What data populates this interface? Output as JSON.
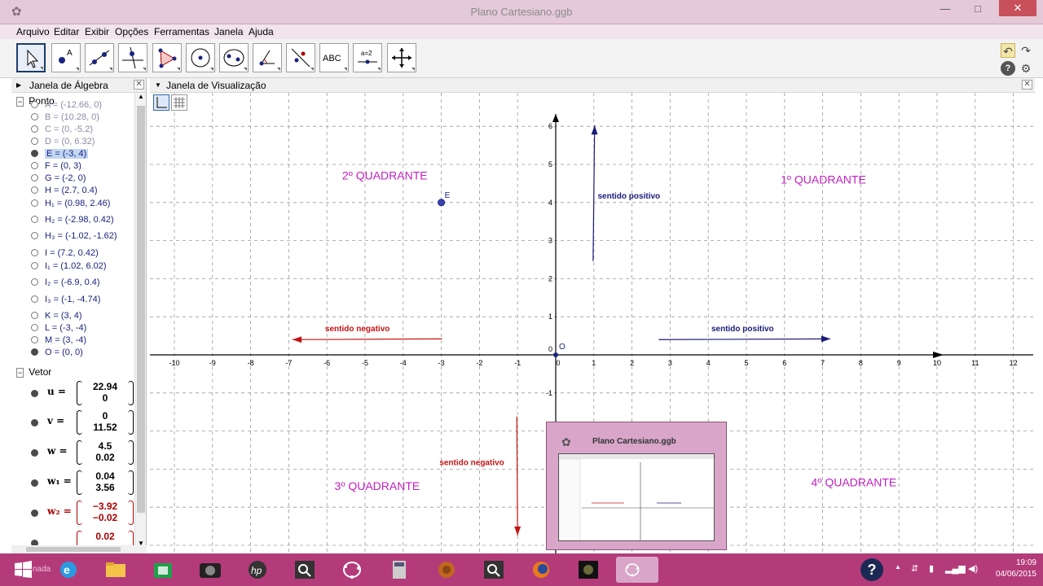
{
  "window": {
    "title": "Plano Cartesiano.ggb",
    "min_label": "—",
    "max_label": "□",
    "close_label": "✕"
  },
  "menu": [
    "Arquivo",
    "Editar",
    "Exibir",
    "Opções",
    "Ferramentas",
    "Janela",
    "Ajuda"
  ],
  "toolbar": {
    "tools": [
      "move-tool",
      "point-tool",
      "line-tool",
      "perpendicular-line-tool",
      "polygon-tool",
      "circle-tool",
      "conic-tool",
      "angle-tool",
      "reflect-tool",
      "text-tool",
      "slider-tool",
      "move-view-tool"
    ],
    "text_tool_label": "ABC",
    "slider_tool_label": "a=2",
    "undo": "↶",
    "redo": "↷",
    "help": "?",
    "settings": "⚙"
  },
  "algebra": {
    "title": "Janela de Álgebra",
    "close": "✕",
    "group_points": "Ponto",
    "points": [
      {
        "label": "A = (-12.66, 0)",
        "shown": false,
        "aux": true
      },
      {
        "label": "B = (10.28, 0)",
        "shown": false,
        "aux": true
      },
      {
        "label": "C = (0, -5.2)",
        "shown": false,
        "aux": true
      },
      {
        "label": "D = (0, 6.32)",
        "shown": false,
        "aux": true
      },
      {
        "label": "E = (-3, 4)",
        "shown": true,
        "aux": false,
        "selected": true
      },
      {
        "label": "F = (0, 3)",
        "shown": false,
        "aux": false
      },
      {
        "label": "G = (-2, 0)",
        "shown": false,
        "aux": false
      },
      {
        "label": "H = (2.7, 0.4)",
        "shown": false,
        "aux": false
      },
      {
        "label": "H₁ = (0.98, 2.46)",
        "shown": false,
        "aux": false
      },
      {
        "label": "H₂ = (-2.98, 0.42)",
        "shown": false,
        "aux": false
      },
      {
        "label": "H₃ = (-1.02, -1.62)",
        "shown": false,
        "aux": false
      },
      {
        "label": "I = (7.2, 0.42)",
        "shown": false,
        "aux": false
      },
      {
        "label": "I₁ = (1.02, 6.02)",
        "shown": false,
        "aux": false
      },
      {
        "label": "I₂ = (-6.9, 0.4)",
        "shown": false,
        "aux": false
      },
      {
        "label": "I₃ = (-1, -4.74)",
        "shown": false,
        "aux": false
      },
      {
        "label": "K = (3, 4)",
        "shown": false,
        "aux": false
      },
      {
        "label": "L = (-3, -4)",
        "shown": false,
        "aux": false
      },
      {
        "label": "M = (3, -4)",
        "shown": false,
        "aux": false
      },
      {
        "label": "O = (0, 0)",
        "shown": true,
        "aux": false
      }
    ],
    "group_vectors": "Vetor",
    "vectors": [
      {
        "name": "u",
        "top": "22.94",
        "bottom": "0",
        "color": "black"
      },
      {
        "name": "v",
        "top": "0",
        "bottom": "11.52",
        "color": "black"
      },
      {
        "name": "w",
        "top": "4.5",
        "bottom": "0.02",
        "color": "black"
      },
      {
        "name": "w₁",
        "top": "0.04",
        "bottom": "3.56",
        "color": "black"
      },
      {
        "name": "w₂",
        "top": "−3.92",
        "bottom": "−0.02",
        "color": "red"
      },
      {
        "name": "",
        "top": "0.02",
        "bottom": "",
        "color": "red"
      }
    ]
  },
  "graphics": {
    "title": "Janela de Visualização",
    "close": "✕",
    "x_ticks": [
      "-10",
      "-9",
      "-8",
      "-7",
      "-6",
      "-5",
      "-4",
      "-3",
      "-2",
      "-1",
      "0",
      "1",
      "2",
      "3",
      "4",
      "5",
      "6",
      "7",
      "8",
      "9",
      "10",
      "11",
      "12"
    ],
    "y_ticks": [
      "6",
      "5",
      "4",
      "3",
      "2",
      "1",
      "0",
      "-1"
    ],
    "quadrants": [
      "2º QUADRANTE",
      "1º QUADRANTE",
      "3º QUADRANTE",
      "4º QUADRANTE"
    ],
    "arrow_labels": {
      "pos_y": "sentido positivo",
      "neg_x": "sentido negativo",
      "pos_x": "sentido positivo",
      "neg_y": "sentido negativo"
    },
    "point_labels": {
      "E": "E",
      "O": "O"
    },
    "accent_magenta": "#c21fc2",
    "arrow_blue": "#1a1a7a",
    "arrow_red": "#c41414"
  },
  "thumbnail": {
    "title": "Plano Cartesiano.ggb"
  },
  "taskbar": {
    "search_hint": "nada",
    "apps": [
      "start-icon",
      "internet-explorer-icon",
      "file-explorer-icon",
      "store-icon",
      "camera-icon",
      "hp-icon",
      "search-icon",
      "geogebra-icon",
      "calculator-icon",
      "baseball-glove-icon",
      "search-icon",
      "firefox-icon",
      "media-icon",
      "geogebra-icon"
    ],
    "time": "19:09",
    "date": "04/06/2015",
    "help": "?"
  }
}
